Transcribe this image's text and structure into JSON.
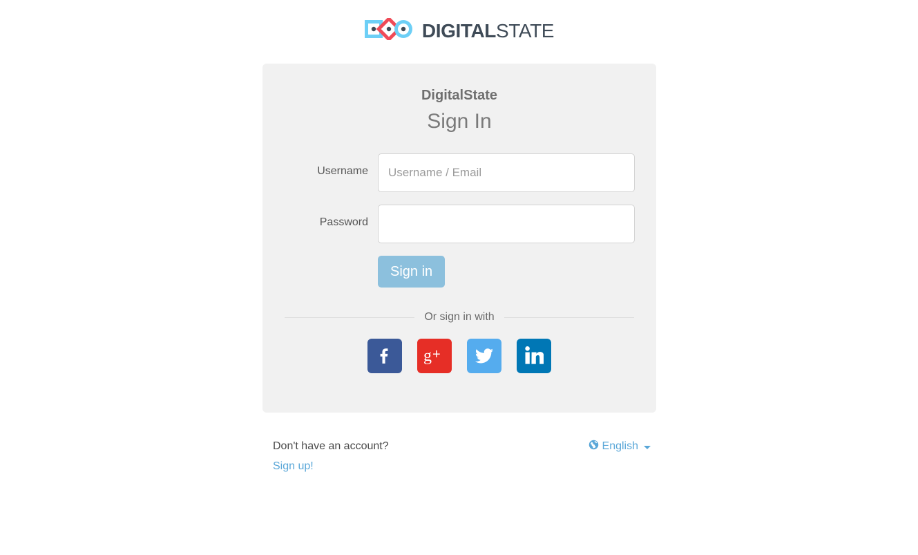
{
  "brand": {
    "logo_icon": "digitalstate-logo-icon",
    "name_strong": "DIGITAL",
    "name_light": "STATE",
    "colors": {
      "square": "#6dcff6",
      "diamond": "#ef4a57",
      "circle": "#6dcff6",
      "dot": "#3f4b57",
      "wordmark": "#3f4b57"
    }
  },
  "card": {
    "title": "DigitalState",
    "subtitle": "Sign In"
  },
  "form": {
    "username": {
      "label": "Username",
      "placeholder": "Username / Email",
      "value": ""
    },
    "password": {
      "label": "Password",
      "placeholder": "",
      "value": ""
    },
    "submit_label": "Sign in",
    "submit_color": "#8cc0dd"
  },
  "divider": {
    "text": "Or sign in with"
  },
  "social": [
    {
      "name": "facebook",
      "label": "Facebook",
      "glyph": "f",
      "color": "#3b5998"
    },
    {
      "name": "google-plus",
      "label": "Google+",
      "glyph": "g+",
      "color": "#e62e26"
    },
    {
      "name": "twitter",
      "label": "Twitter",
      "glyph": "bird",
      "color": "#55acee"
    },
    {
      "name": "linkedin",
      "label": "LinkedIn",
      "glyph": "in",
      "color": "#0077b5"
    }
  ],
  "footer": {
    "question": "Don't have an account?",
    "signup_label": "Sign up!",
    "language_icon": "globe-icon",
    "language_label": "English",
    "link_color": "#5aa7d8"
  }
}
